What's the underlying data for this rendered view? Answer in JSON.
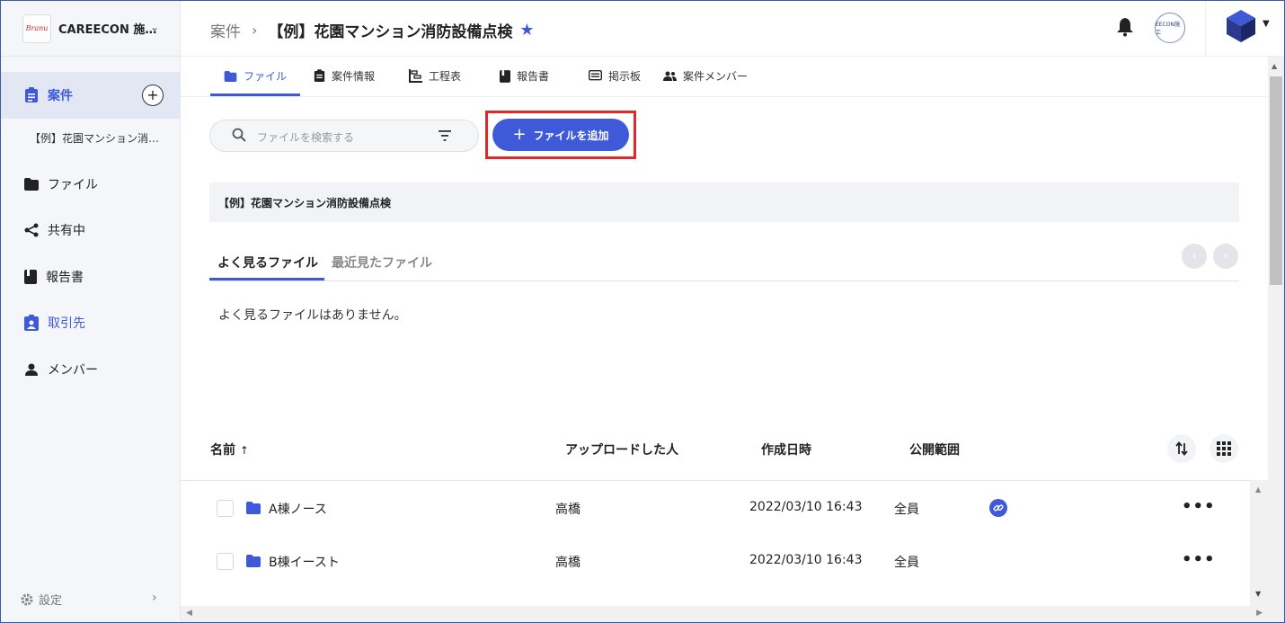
{
  "workspace": {
    "logo_text": "Branu",
    "name": "CAREECON 施…"
  },
  "sidebar": {
    "active_label": "案件",
    "project_name": "【例】花園マンション消…",
    "items": [
      {
        "label": "ファイル"
      },
      {
        "label": "共有中"
      },
      {
        "label": "報告書"
      },
      {
        "label": "取引先"
      },
      {
        "label": "メンバー"
      }
    ],
    "settings_label": "設定"
  },
  "header": {
    "crumb_root": "案件",
    "crumb_sep": "›",
    "crumb_title": "【例】花園マンション消防設備点検",
    "org_avatar_text": "EECON施工"
  },
  "tabs": [
    {
      "label": "ファイル"
    },
    {
      "label": "案件情報"
    },
    {
      "label": "工程表"
    },
    {
      "label": "報告書"
    },
    {
      "label": "掲示板"
    },
    {
      "label": "案件メンバー"
    }
  ],
  "search": {
    "placeholder": "ファイルを検索する"
  },
  "add_button_label": "ファイルを追加",
  "folder_path": "【例】花園マンション消防設備点検",
  "file_tabs": {
    "active": "よく見るファイル",
    "inactive": "最近見たファイル"
  },
  "empty_message": "よく見るファイルはありません。",
  "table": {
    "columns": {
      "name": "名前",
      "sort_arrow": "↑",
      "uploader": "アップロードした人",
      "created": "作成日時",
      "scope": "公開範囲"
    },
    "rows": [
      {
        "name": "A棟ノース",
        "uploader": "高橋",
        "created": "2022/03/10 16:43",
        "scope": "全員",
        "linked": true
      },
      {
        "name": "B棟イースト",
        "uploader": "高橋",
        "created": "2022/03/10 16:43",
        "scope": "全員",
        "linked": false
      }
    ]
  },
  "colors": {
    "accent": "#3f5ad8",
    "highlight": "#e02a2a"
  }
}
